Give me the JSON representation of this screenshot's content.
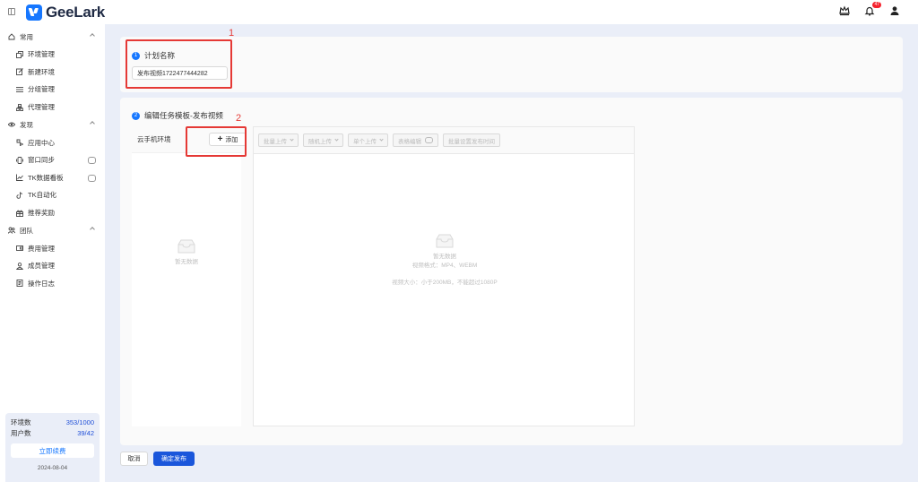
{
  "app": {
    "name": "GeeLark"
  },
  "topbar": {
    "notification_count": "47"
  },
  "sidebar": {
    "groups": [
      {
        "label": "常用",
        "items": [
          {
            "label": "环境管理",
            "icon": "copy-icon"
          },
          {
            "label": "新建环境",
            "icon": "edit-icon"
          },
          {
            "label": "分组管理",
            "icon": "list-icon"
          },
          {
            "label": "代理管理",
            "icon": "network-icon"
          }
        ]
      },
      {
        "label": "发现",
        "items": [
          {
            "label": "应用中心",
            "icon": "apps-icon"
          },
          {
            "label": "窗口同步",
            "icon": "sync-icon"
          },
          {
            "label": "TK数据看板",
            "icon": "chart-icon"
          },
          {
            "label": "TK自动化",
            "icon": "tiktok-icon"
          },
          {
            "label": "推荐奖励",
            "icon": "gift-icon"
          }
        ]
      },
      {
        "label": "团队",
        "items": [
          {
            "label": "费用管理",
            "icon": "wallet-icon"
          },
          {
            "label": "成员管理",
            "icon": "members-icon"
          },
          {
            "label": "操作日志",
            "icon": "log-icon"
          }
        ]
      }
    ],
    "stats": {
      "env_label": "环境数",
      "env_value": "353/1000",
      "user_label": "用户数",
      "user_value": "39/42",
      "renew_label": "立即续费",
      "expiry_date": "2024-08-04"
    }
  },
  "main": {
    "step1": {
      "num": "1",
      "title": "计划名称",
      "input_value": "发布视频1722477444282"
    },
    "step2": {
      "num": "2",
      "title": "编辑任务模板-发布视频"
    },
    "env_panel": {
      "title": "云手机环境",
      "add_label": "添加",
      "empty_text": "暂无数据"
    },
    "video_toolbar": [
      {
        "label": "批量上传",
        "has_dropdown": true
      },
      {
        "label": "随机上传",
        "has_dropdown": true
      },
      {
        "label": "单个上传",
        "has_dropdown": true
      },
      {
        "label": "表格编辑",
        "has_dropdown": false
      },
      {
        "label": "批量设置发布时间",
        "has_dropdown": false
      }
    ],
    "video_empty": {
      "title": "暂无数据",
      "formats": "视频格式：MP4、WEBM",
      "size": "视频大小：小于200MB，不能超过1080P"
    },
    "annotations": {
      "label1": "1",
      "label2": "2"
    },
    "footer": {
      "cancel_label": "取消",
      "confirm_label": "确定发布"
    }
  },
  "colors": {
    "accent": "#1677ff",
    "annotation": "#e53935",
    "confirm": "#1a56db"
  }
}
